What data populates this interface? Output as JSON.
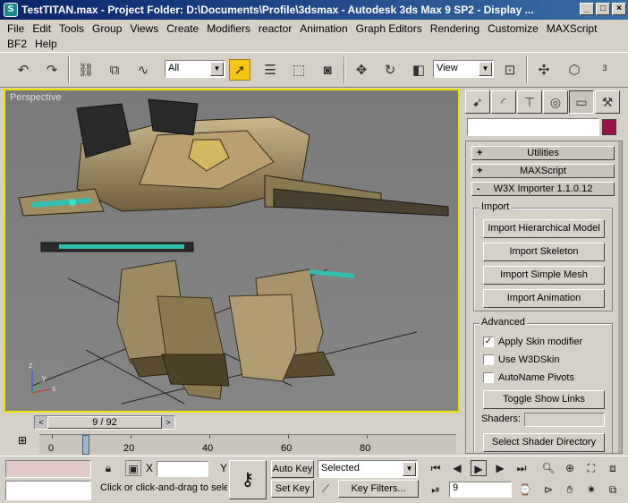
{
  "window": {
    "title": "TestTITAN.max   - Project Folder: D:\\Documents\\Profile\\3dsmax   - Autodesk 3ds Max 9 SP2   - Display ...",
    "app_icon": "3ds-max-icon",
    "buttons": [
      "minimize",
      "maximize",
      "close"
    ]
  },
  "menubar": {
    "items": [
      "File",
      "Edit",
      "Tools",
      "Group",
      "Views",
      "Create",
      "Modifiers",
      "reactor",
      "Animation",
      "Graph Editors",
      "Rendering",
      "Customize",
      "MAXScript",
      "BF2",
      "Help"
    ]
  },
  "toolbar": {
    "selection_filter": "All",
    "reference_coord": "View",
    "icons": [
      "undo-icon",
      "redo-icon",
      "select-and-link-icon",
      "unlink-icon",
      "bind-space-warp-icon",
      "select-object-icon",
      "select-by-name-icon",
      "rectangular-selection-icon",
      "window-crossing-icon",
      "select-and-move-icon",
      "select-and-rotate-icon",
      "select-and-scale-icon",
      "use-pivot-center-icon",
      "select-manipulate-icon",
      "snap-toggle-icon"
    ]
  },
  "viewport": {
    "label": "Perspective",
    "axis_labels": {
      "x": "x",
      "y": "y",
      "z": "z"
    }
  },
  "timeslider": {
    "value": "9 / 92"
  },
  "trackbar": {
    "ticks": [
      "0",
      "20",
      "40",
      "60",
      "80"
    ]
  },
  "statusbar": {
    "x_label": "X",
    "y_label": "Y",
    "prompt": "Click or click-and-drag to sele",
    "auto_key": "Auto Key",
    "set_key": "Set Key",
    "selected_dropdown": "Selected",
    "key_filters": "Key Filters...",
    "frame_value": "9"
  },
  "command_panel": {
    "tabs": [
      "create-tab",
      "modify-tab",
      "hierarchy-tab",
      "motion-tab",
      "display-tab",
      "utilities-tab"
    ],
    "rollouts": [
      {
        "sign": "+",
        "label": "Utilities"
      },
      {
        "sign": "+",
        "label": "MAXScript"
      },
      {
        "sign": "-",
        "label": "W3X Importer 1.1.0.12"
      }
    ],
    "import_group": {
      "title": "Import",
      "buttons": [
        "Import Hierarchical Model",
        "Import Skeleton",
        "Import Simple Mesh",
        "Import Animation"
      ]
    },
    "advanced_group": {
      "title": "Advanced",
      "checkboxes": [
        {
          "label": "Apply Skin modifier",
          "checked": true
        },
        {
          "label": "Use W3DSkin",
          "checked": false
        },
        {
          "label": "AutoName Pivots",
          "checked": false
        }
      ],
      "toggle_button": "Toggle Show Links",
      "shaders_label": "Shaders:",
      "shader_dir_button": "Select Shader Directory"
    },
    "swatch_color": "#9c1248"
  }
}
